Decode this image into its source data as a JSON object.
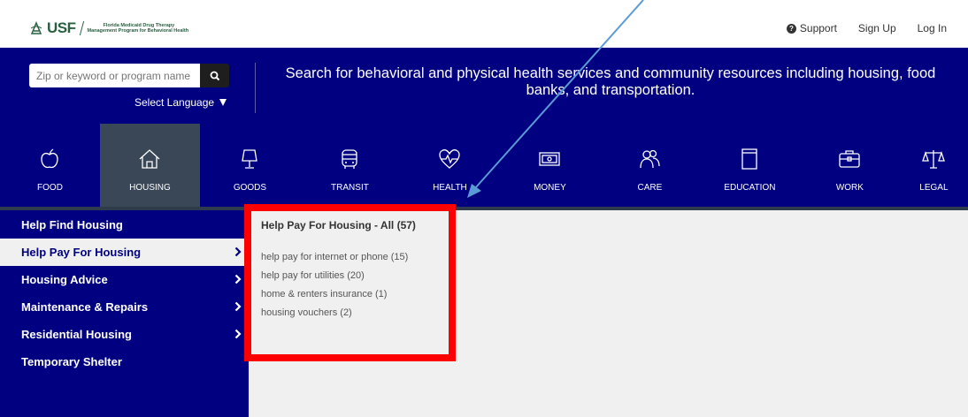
{
  "header": {
    "logo_text": "USF",
    "logo_org_line1": "Florida Medicaid Drug Therapy",
    "logo_org_line2": "Management Program for Behavioral Health",
    "links": {
      "support": "Support",
      "signup": "Sign Up",
      "login": "Log In"
    }
  },
  "search": {
    "placeholder": "Zip or keyword or program name",
    "language_label": "Select Language"
  },
  "tagline": "Search for behavioral and physical health services and community resources including housing, food banks, and transportation.",
  "categories": [
    {
      "label": "FOOD",
      "icon": "apple-icon"
    },
    {
      "label": "HOUSING",
      "icon": "house-icon",
      "active": true
    },
    {
      "label": "GOODS",
      "icon": "lamp-icon"
    },
    {
      "label": "TRANSIT",
      "icon": "bus-icon"
    },
    {
      "label": "HEALTH",
      "icon": "heartbeat-icon"
    },
    {
      "label": "MONEY",
      "icon": "money-icon"
    },
    {
      "label": "CARE",
      "icon": "people-icon"
    },
    {
      "label": "EDUCATION",
      "icon": "book-icon"
    },
    {
      "label": "WORK",
      "icon": "briefcase-icon"
    },
    {
      "label": "LEGAL",
      "icon": "scales-icon"
    }
  ],
  "sidebar": {
    "items": [
      {
        "label": "Help Find Housing",
        "has_children": false
      },
      {
        "label": "Help Pay For Housing",
        "has_children": true,
        "selected": true
      },
      {
        "label": "Housing Advice",
        "has_children": true
      },
      {
        "label": "Maintenance & Repairs",
        "has_children": true
      },
      {
        "label": "Residential Housing",
        "has_children": true
      },
      {
        "label": "Temporary Shelter",
        "has_children": false
      }
    ]
  },
  "submenu": {
    "title": "Help Pay For Housing - All (57)",
    "items": [
      "help pay for internet or phone (15)",
      "help pay for utilities (20)",
      "home & renters insurance (1)",
      "housing vouchers (2)"
    ]
  },
  "colors": {
    "nav_bg": "#000080",
    "active_cat": "#3a4757",
    "content_bg": "#f0f0f0",
    "annotation_red": "#ff0000",
    "annotation_arrow": "#5b9bd5"
  }
}
